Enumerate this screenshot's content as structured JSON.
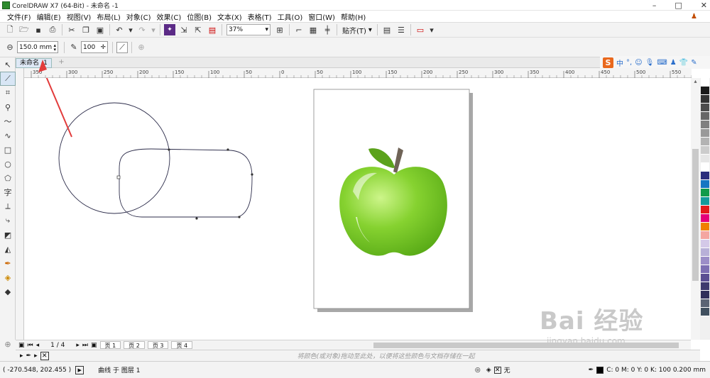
{
  "window": {
    "title": "CorelDRAW X7 (64-Bit) - 未命名 -1",
    "controls": [
      "–",
      "□",
      "✕"
    ]
  },
  "menu": {
    "items": [
      "文件(F)",
      "编辑(E)",
      "视图(V)",
      "布局(L)",
      "对象(C)",
      "效果(C)",
      "位图(B)",
      "文本(X)",
      "表格(T)",
      "工具(O)",
      "窗口(W)",
      "帮助(H)"
    ]
  },
  "toolbar": {
    "zoom": "37%",
    "snap": "贴齐(T)"
  },
  "propertybar": {
    "size": "150.0 mm",
    "opacity": "100"
  },
  "doctab": {
    "label": "未命名 -1",
    "plus": "+"
  },
  "ime": {
    "logo": "S",
    "lang": "中"
  },
  "ruler": {
    "ticks": [
      "350",
      "300",
      "250",
      "200",
      "150",
      "100",
      "50",
      "0",
      "50",
      "100",
      "150",
      "200",
      "250",
      "300",
      "350",
      "400",
      "450",
      "500",
      "550",
      "600",
      "650",
      "700",
      "750",
      "800"
    ],
    "unit": "毫米"
  },
  "toolbox": {
    "text_tool": "字"
  },
  "pages": {
    "counter": "1 / 4",
    "tabs": [
      "页 1",
      "页 2",
      "页 3",
      "页 4"
    ]
  },
  "colorhint": {
    "message": "将颜色(或对象)拖动至此处，以便将这些颜色与文档存储在一起"
  },
  "status": {
    "coords": "( -270.548, 202.455 )",
    "object": "曲线 于 图层 1",
    "fill_label": "无",
    "outline": "C: 0 M: 0 Y: 0 K: 100  0.200 mm"
  },
  "palette": [
    "#ffffff",
    "#1a1a1a",
    "#333333",
    "#4d4d4d",
    "#666666",
    "#808080",
    "#999999",
    "#b3b3b3",
    "#cccccc",
    "#e6e6e6",
    "#ffffff",
    "#2b2d7c",
    "#1577c2",
    "#109b4a",
    "#149b9b",
    "#e41b1b",
    "#e4007a",
    "#f08000",
    "#f4a6a0",
    "#d4c9e8",
    "#b8b0d8",
    "#9c8ec8",
    "#7d6fb3",
    "#5b4f93",
    "#3e3a6e",
    "#2f2f5a",
    "#5a6474",
    "#40505f"
  ],
  "watermark": {
    "brand": "Bai 经验",
    "url": "jingyan.baidu.com"
  }
}
